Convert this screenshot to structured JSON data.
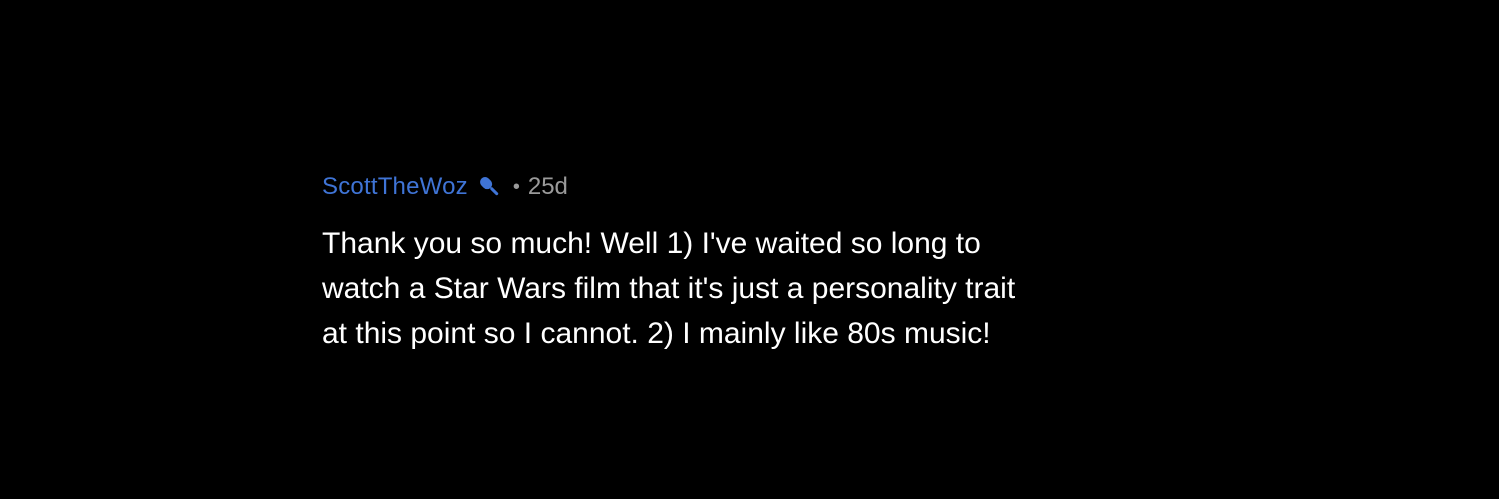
{
  "comment": {
    "username": "ScottTheWoz",
    "badge_icon": "microphone-icon",
    "separator": "•",
    "age": "25d",
    "lines": [
      "Thank you so much! Well 1) I've waited so long to",
      "watch a Star Wars film that it's just a personality trait",
      "at this point so I cannot. 2) I mainly like 80s music!"
    ]
  },
  "colors": {
    "background": "#000000",
    "username": "#3f74d6",
    "meta": "#9a9a9a",
    "text": "#ffffff"
  }
}
